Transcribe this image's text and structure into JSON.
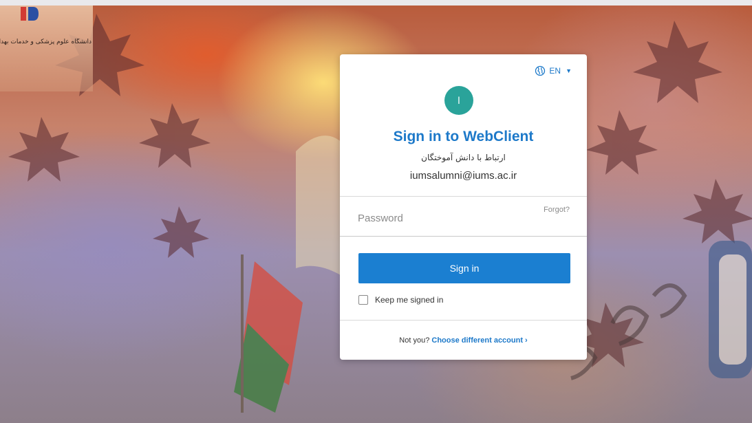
{
  "logo": {
    "text": "دانشگاه علوم پزشکی و خدمات بهداشتی درمانی"
  },
  "card": {
    "language": "EN",
    "avatar_initial": "ا",
    "title": "Sign in to WebClient",
    "subtitle": "ارتباط با دانش آموختگان",
    "email": "iumsalumni@iums.ac.ir",
    "password_placeholder": "Password",
    "forgot_label": "Forgot?",
    "signin_label": "Sign in",
    "keep_signed_in_label": "Keep me signed in",
    "not_you_label": "Not you?",
    "choose_account_label": "Choose different account ›"
  },
  "colors": {
    "accent": "#1d79c9",
    "button": "#1b7fd1",
    "avatar": "#2aa39a"
  }
}
